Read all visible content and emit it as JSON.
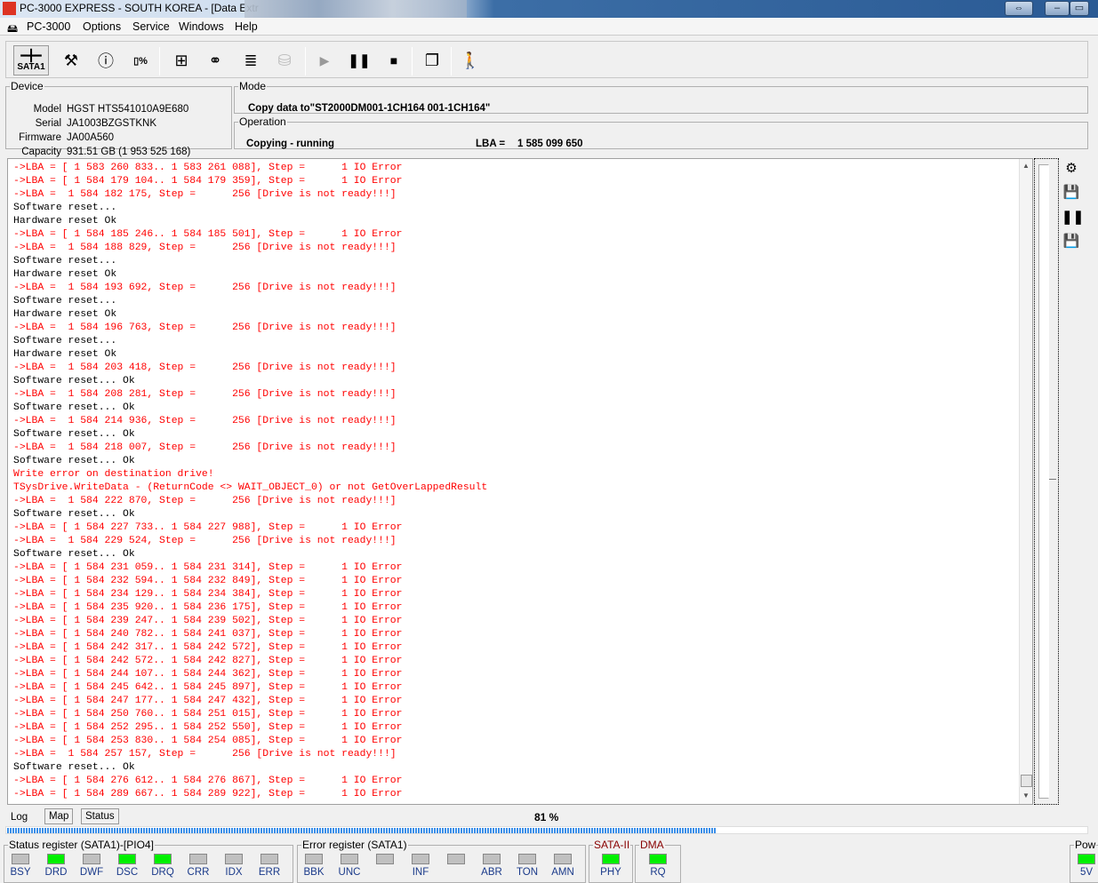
{
  "window": {
    "title": "PC-3000 EXPRESS - SOUTH KOREA - [Data Extr",
    "app_icon": "PC"
  },
  "menu": [
    "PC-3000",
    "Options",
    "Service",
    "Windows",
    "Help"
  ],
  "toolbar": {
    "sata_label": "SATA1"
  },
  "device": {
    "legend": "Device",
    "fields": [
      {
        "label": "Model",
        "value": "HGST HTS541010A9E680"
      },
      {
        "label": "Serial",
        "value": "JA1003BZGSTKNK"
      },
      {
        "label": "Firmware",
        "value": "JA00A560"
      },
      {
        "label": "Capacity",
        "value": "931.51 GB (1 953 525 168)"
      }
    ]
  },
  "mode": {
    "legend": "Mode",
    "value": "Copy data to\"ST2000DM001-1CH164 001-1CH164\""
  },
  "operation": {
    "legend": "Operation",
    "status": "Copying - running",
    "lba_label": "LBA =",
    "lba_value": "1 585 099 650"
  },
  "log": [
    [
      "r",
      "->LBA = [ 1 583 260 833.. 1 583 261 088], Step =      1 IO Error"
    ],
    [
      "r",
      "->LBA = [ 1 584 179 104.. 1 584 179 359], Step =      1 IO Error"
    ],
    [
      "r",
      "->LBA =  1 584 182 175, Step =      256 [Drive is not ready!!!]"
    ],
    [
      "k",
      "Software reset..."
    ],
    [
      "k",
      "Hardware reset Ok"
    ],
    [
      "r",
      "->LBA = [ 1 584 185 246.. 1 584 185 501], Step =      1 IO Error"
    ],
    [
      "r",
      "->LBA =  1 584 188 829, Step =      256 [Drive is not ready!!!]"
    ],
    [
      "k",
      "Software reset..."
    ],
    [
      "k",
      "Hardware reset Ok"
    ],
    [
      "r",
      "->LBA =  1 584 193 692, Step =      256 [Drive is not ready!!!]"
    ],
    [
      "k",
      "Software reset..."
    ],
    [
      "k",
      "Hardware reset Ok"
    ],
    [
      "r",
      "->LBA =  1 584 196 763, Step =      256 [Drive is not ready!!!]"
    ],
    [
      "k",
      "Software reset..."
    ],
    [
      "k",
      "Hardware reset Ok"
    ],
    [
      "r",
      "->LBA =  1 584 203 418, Step =      256 [Drive is not ready!!!]"
    ],
    [
      "k",
      "Software reset... Ok"
    ],
    [
      "r",
      "->LBA =  1 584 208 281, Step =      256 [Drive is not ready!!!]"
    ],
    [
      "k",
      "Software reset... Ok"
    ],
    [
      "r",
      "->LBA =  1 584 214 936, Step =      256 [Drive is not ready!!!]"
    ],
    [
      "k",
      "Software reset... Ok"
    ],
    [
      "r",
      "->LBA =  1 584 218 007, Step =      256 [Drive is not ready!!!]"
    ],
    [
      "k",
      "Software reset... Ok"
    ],
    [
      "r",
      "Write error on destination drive!"
    ],
    [
      "r",
      "TSysDrive.WriteData - (ReturnCode <> WAIT_OBJECT_0) or not GetOverLappedResult"
    ],
    [
      "r",
      "->LBA =  1 584 222 870, Step =      256 [Drive is not ready!!!]"
    ],
    [
      "k",
      "Software reset... Ok"
    ],
    [
      "r",
      "->LBA = [ 1 584 227 733.. 1 584 227 988], Step =      1 IO Error"
    ],
    [
      "r",
      "->LBA =  1 584 229 524, Step =      256 [Drive is not ready!!!]"
    ],
    [
      "k",
      "Software reset... Ok"
    ],
    [
      "r",
      "->LBA = [ 1 584 231 059.. 1 584 231 314], Step =      1 IO Error"
    ],
    [
      "r",
      "->LBA = [ 1 584 232 594.. 1 584 232 849], Step =      1 IO Error"
    ],
    [
      "r",
      "->LBA = [ 1 584 234 129.. 1 584 234 384], Step =      1 IO Error"
    ],
    [
      "r",
      "->LBA = [ 1 584 235 920.. 1 584 236 175], Step =      1 IO Error"
    ],
    [
      "r",
      "->LBA = [ 1 584 239 247.. 1 584 239 502], Step =      1 IO Error"
    ],
    [
      "r",
      "->LBA = [ 1 584 240 782.. 1 584 241 037], Step =      1 IO Error"
    ],
    [
      "r",
      "->LBA = [ 1 584 242 317.. 1 584 242 572], Step =      1 IO Error"
    ],
    [
      "r",
      "->LBA = [ 1 584 242 572.. 1 584 242 827], Step =      1 IO Error"
    ],
    [
      "r",
      "->LBA = [ 1 584 244 107.. 1 584 244 362], Step =      1 IO Error"
    ],
    [
      "r",
      "->LBA = [ 1 584 245 642.. 1 584 245 897], Step =      1 IO Error"
    ],
    [
      "r",
      "->LBA = [ 1 584 247 177.. 1 584 247 432], Step =      1 IO Error"
    ],
    [
      "r",
      "->LBA = [ 1 584 250 760.. 1 584 251 015], Step =      1 IO Error"
    ],
    [
      "r",
      "->LBA = [ 1 584 252 295.. 1 584 252 550], Step =      1 IO Error"
    ],
    [
      "r",
      "->LBA = [ 1 584 253 830.. 1 584 254 085], Step =      1 IO Error"
    ],
    [
      "r",
      "->LBA =  1 584 257 157, Step =      256 [Drive is not ready!!!]"
    ],
    [
      "k",
      "Software reset... Ok"
    ],
    [
      "r",
      "->LBA = [ 1 584 276 612.. 1 584 276 867], Step =      1 IO Error"
    ],
    [
      "r",
      "->LBA = [ 1 584 289 667.. 1 584 289 922], Step =      1 IO Error"
    ]
  ],
  "tabs": [
    "Log",
    "Map",
    "Status"
  ],
  "progress": {
    "text": "81 %",
    "percent": 81
  },
  "status_register": {
    "legend": "Status register (SATA1)-[PIO4]",
    "leds": [
      {
        "l": "BSY",
        "on": false
      },
      {
        "l": "DRD",
        "on": true
      },
      {
        "l": "DWF",
        "on": false
      },
      {
        "l": "DSC",
        "on": true
      },
      {
        "l": "DRQ",
        "on": true
      },
      {
        "l": "CRR",
        "on": false
      },
      {
        "l": "IDX",
        "on": false
      },
      {
        "l": "ERR",
        "on": false
      }
    ]
  },
  "error_register": {
    "legend": "Error register (SATA1)",
    "leds": [
      {
        "l": "BBK",
        "on": false
      },
      {
        "l": "UNC",
        "on": false
      },
      {
        "l": "",
        "on": false
      },
      {
        "l": "INF",
        "on": false
      },
      {
        "l": "",
        "on": false
      },
      {
        "l": "ABR",
        "on": false
      },
      {
        "l": "TON",
        "on": false
      },
      {
        "l": "AMN",
        "on": false
      }
    ]
  },
  "sata": {
    "legend": "SATA-II",
    "leds": [
      {
        "l": "PHY",
        "on": true
      }
    ]
  },
  "dma": {
    "legend": "DMA",
    "leds": [
      {
        "l": "RQ",
        "on": true
      }
    ]
  },
  "power": {
    "legend": "Pow",
    "leds": [
      {
        "l": "5V",
        "on": true
      }
    ]
  },
  "colors": {
    "led_on": "#00f000",
    "led_off": "#c0c0c0",
    "error_text": "#ff0000"
  }
}
